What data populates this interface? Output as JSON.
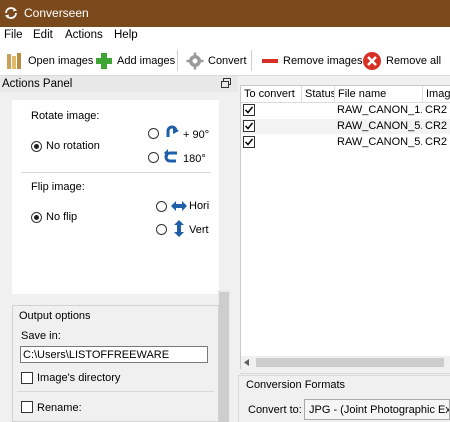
{
  "window": {
    "title": "Converseen"
  },
  "menu": [
    "File",
    "Edit",
    "Actions",
    "Help"
  ],
  "toolbar": {
    "open_images": "Open images",
    "add_images": "Add images",
    "convert": "Convert",
    "remove_images": "Remove images",
    "remove_all": "Remove all"
  },
  "actions_panel": {
    "title": "Actions Panel",
    "rotate": {
      "label": "Rotate image:",
      "no_rotation": "No rotation",
      "option_90": "+ 90°",
      "option_180": "180°",
      "selected": "No rotation"
    },
    "flip": {
      "label": "Flip image:",
      "no_flip": "No flip",
      "horizontal": "Hori",
      "vertical": "Vert",
      "selected": "No flip"
    },
    "output": {
      "label": "Output options",
      "save_in_label": "Save in:",
      "save_in_value": "C:\\Users\\LISTOFFREEWARE",
      "images_directory": "Image's directory",
      "rename": "Rename:"
    }
  },
  "file_table": {
    "columns": [
      "To convert",
      "Status",
      "File name",
      "Imag"
    ],
    "rows": [
      {
        "checked": true,
        "status": "",
        "file_name": "RAW_CANON_1...",
        "type": "CR2"
      },
      {
        "checked": true,
        "status": "",
        "file_name": "RAW_CANON_5...",
        "type": "CR2"
      },
      {
        "checked": true,
        "status": "",
        "file_name": "RAW_CANON_5...",
        "type": "CR2"
      }
    ]
  },
  "conversion": {
    "group_label": "Conversion Formats",
    "convert_to_label": "Convert to:",
    "format_value": "JPG - (Joint Photographic Experts"
  },
  "colors": {
    "titlebar": "#7a4a1c",
    "remove_all_icon": "#d93025",
    "add_icon": "#3fa535"
  }
}
